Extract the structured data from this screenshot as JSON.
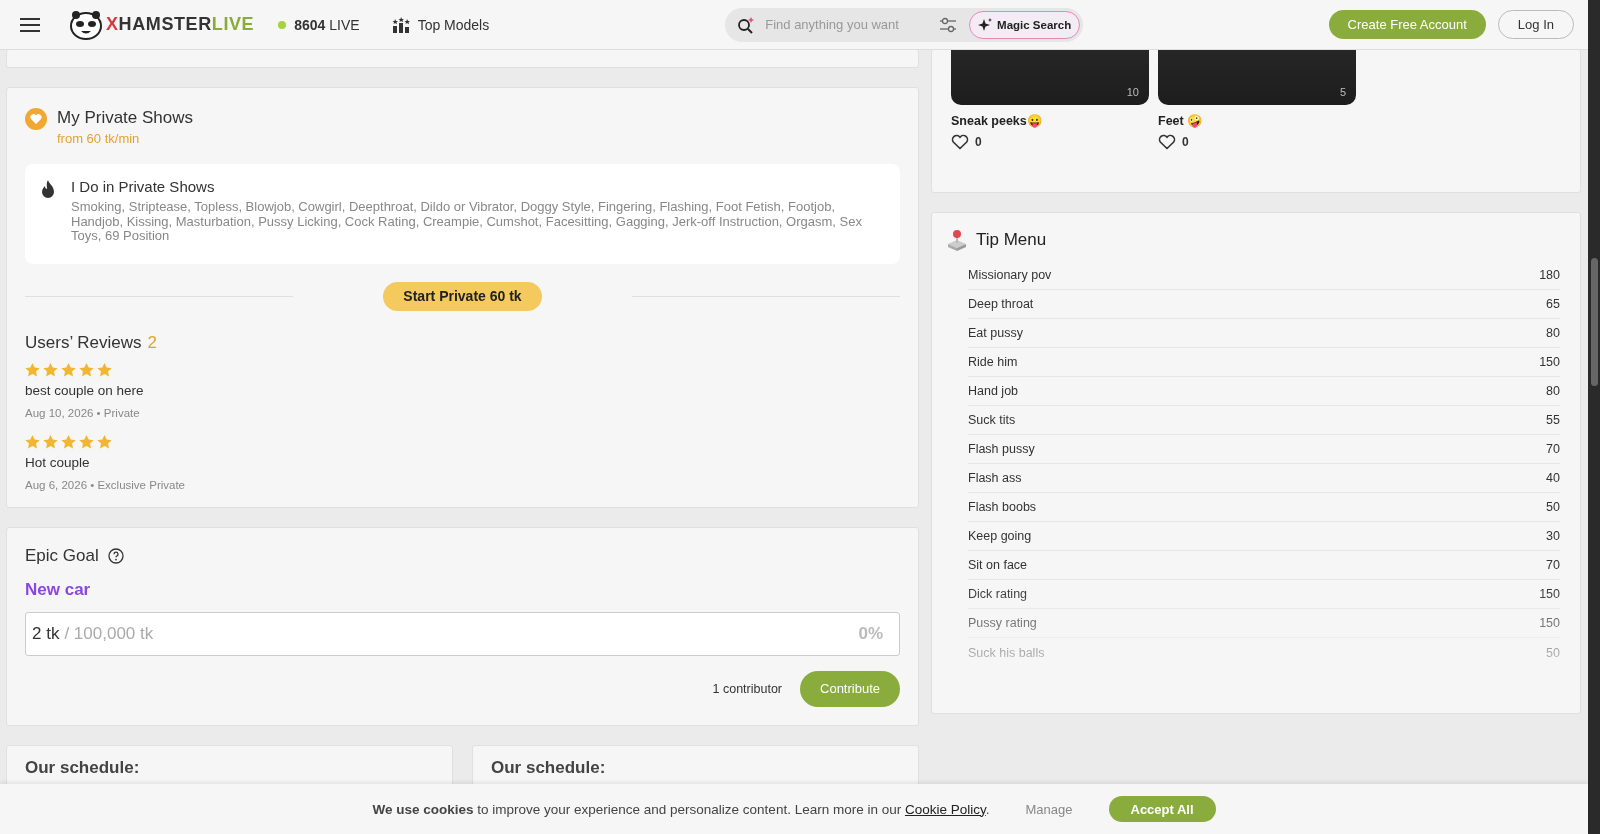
{
  "header": {
    "brand_left": "XHAMSTER",
    "brand_right": "LIVE",
    "live_count": "8604",
    "live_label": "LIVE",
    "top_models": "Top Models",
    "search": {
      "placeholder": "Find anything you want"
    },
    "magic_search": "Magic Search",
    "create_account": "Create Free Account",
    "login": "Log In"
  },
  "media": [
    {
      "count": "10",
      "title": "Sneak peeks😛",
      "likes": "0"
    },
    {
      "count": "5",
      "title": "Feet 🤪",
      "likes": "0"
    }
  ],
  "private_shows": {
    "title": "My Private Shows",
    "price": "from 60 tk/min",
    "do_title": "I Do in Private Shows",
    "do_list": "Smoking, Striptease, Topless, Blowjob, Cowgirl, Deepthroat, Dildo or Vibrator, Doggy Style, Fingering, Flashing, Foot Fetish, Footjob, Handjob, Kissing, Masturbation, Pussy Licking, Cock Rating, Creampie, Cumshot, Facesitting, Gagging, Jerk-off Instruction, Orgasm, Sex Toys, 69 Position",
    "start_button": "Start Private 60 tk"
  },
  "reviews": {
    "title": "Users’ Reviews",
    "count": "2",
    "items": [
      {
        "stars": 5,
        "text": "best couple on here",
        "meta": "Aug 10, 2026 • Private"
      },
      {
        "stars": 5,
        "text": "Hot couple",
        "meta": "Aug 6, 2026 • Exclusive Private"
      }
    ]
  },
  "tip_menu": {
    "title": "Tip Menu",
    "items": [
      {
        "name": "Missionary pov",
        "price": "180"
      },
      {
        "name": "Deep throat",
        "price": "65"
      },
      {
        "name": "Eat pussy",
        "price": "80"
      },
      {
        "name": "Ride him",
        "price": "150"
      },
      {
        "name": "Hand job",
        "price": "80"
      },
      {
        "name": "Suck tits",
        "price": "55"
      },
      {
        "name": "Flash pussy",
        "price": "70"
      },
      {
        "name": "Flash ass",
        "price": "40"
      },
      {
        "name": "Flash boobs",
        "price": "50"
      },
      {
        "name": "Keep going",
        "price": "30"
      },
      {
        "name": "Sit on face",
        "price": "70"
      },
      {
        "name": "Dick rating",
        "price": "150"
      },
      {
        "name": "Pussy rating",
        "price": "150"
      },
      {
        "name": "Suck his balls",
        "price": "50"
      }
    ]
  },
  "epic_goal": {
    "title": "Epic Goal",
    "goal_name": "New car",
    "current": "2 tk",
    "target": "/ 100,000 tk",
    "percent": "0%",
    "level": 0,
    "contributors": "1 contributor",
    "contribute_button": "Contribute"
  },
  "schedules": [
    {
      "title": "Our schedule:"
    },
    {
      "title": "Our schedule:"
    }
  ],
  "cookie_bar": {
    "text": "**We use cookies** to improve your experience and personalize content. Learn more in our",
    "link": "Cookie Policy",
    "after": ".",
    "manage": "Manage",
    "accept": "Accept All"
  }
}
